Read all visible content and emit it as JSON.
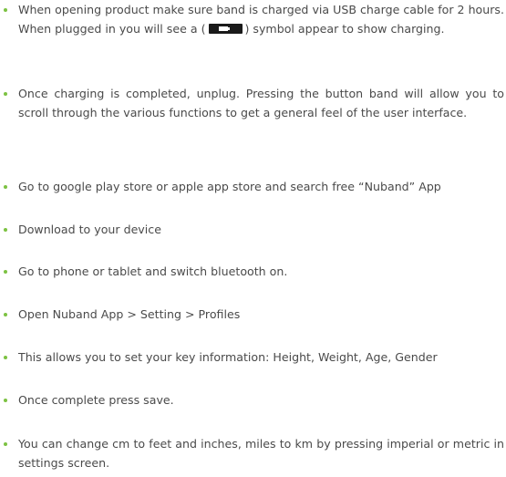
{
  "instructions": [
    {
      "text_before": "When opening product make sure band is charged via USB charge cable for 2 hours. When plugged in you will see a (",
      "icon": "battery-charging-icon",
      "text_after": ") symbol appear to show charging."
    },
    {
      "text": "Once charging is completed, unplug. Pressing the button band will allow you to scroll through the various functions to get a general feel of the user interface."
    },
    {
      "text": "Go to google play store or apple app store and search free “Nuband” App"
    },
    {
      "text": "Download to your device"
    },
    {
      "text": "Go to phone or tablet and switch bluetooth on."
    },
    {
      "text": "Open Nuband App > Setting > Profiles"
    },
    {
      "text": "This allows you to set your key information: Height, Weight, Age, Gender"
    },
    {
      "text": "Once complete press save."
    },
    {
      "text": "You can change cm to feet and inches, miles to km by pressing imperial or metric in settings screen."
    }
  ],
  "colors": {
    "bullet": "#7cc242",
    "text": "#4a4a4a",
    "icon_background": "#1a1a1a"
  }
}
